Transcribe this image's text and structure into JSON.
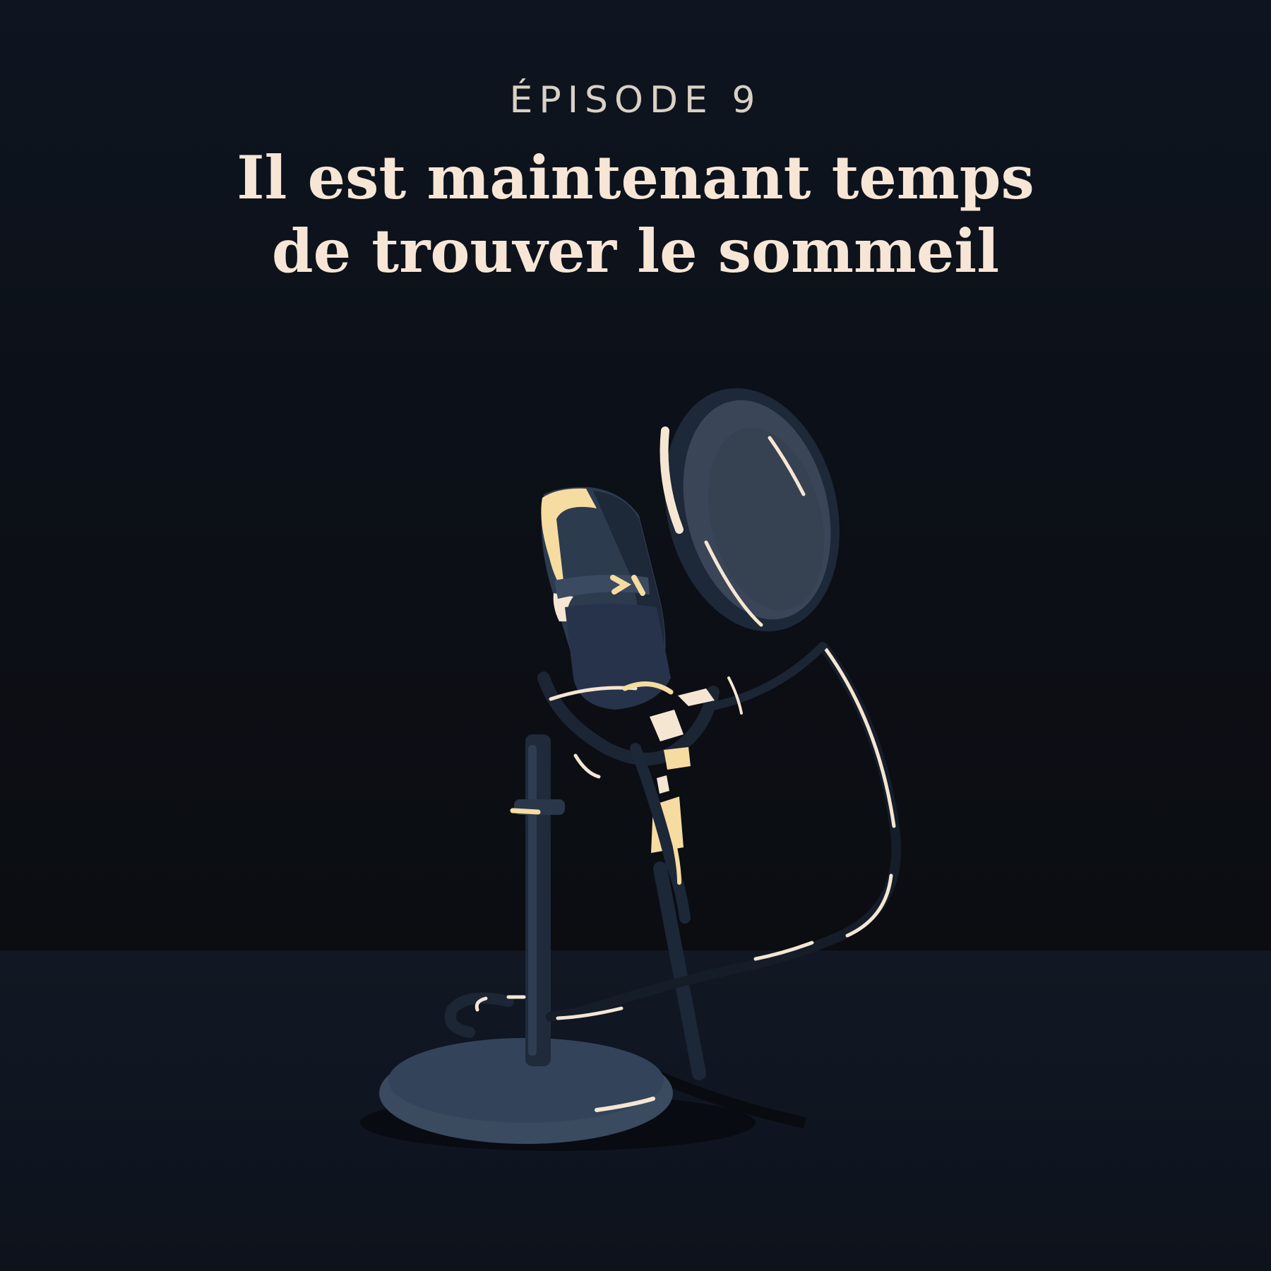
{
  "cover": {
    "episode_label": "ÉPISODE 9",
    "title_lines": [
      "Il est maintenant temps",
      "de trouver le sommeil"
    ]
  },
  "illustration": {
    "subject_icon": "microphone-icon",
    "colors": {
      "background_top": "#0e1520",
      "background_bottom": "#0b0d11",
      "floor": "#111823",
      "metal_dark": "#1d2838",
      "metal_mid": "#2c3a4e",
      "metal_light": "#3a4a60",
      "highlight_cream": "#f5e6d3",
      "highlight_gold": "#f6dca0",
      "filter_mesh": "#3a4558"
    }
  }
}
